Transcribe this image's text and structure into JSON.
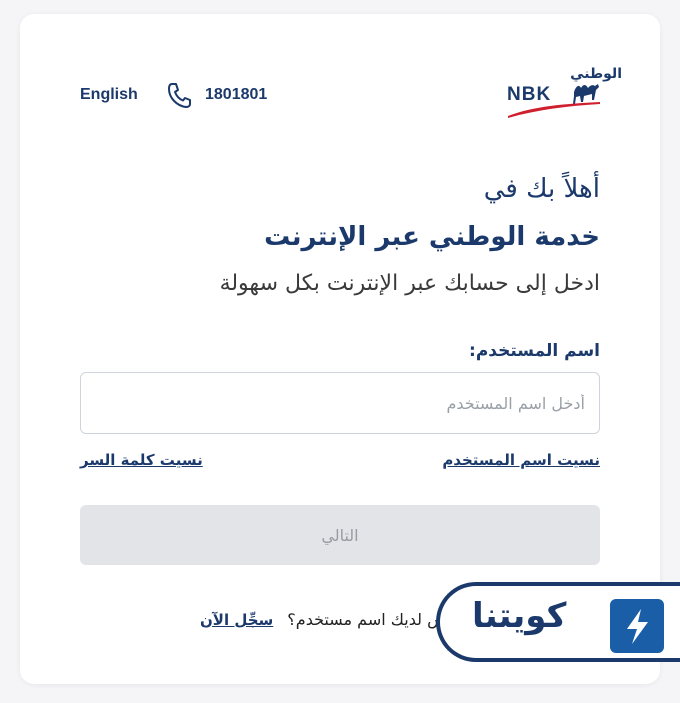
{
  "header": {
    "language_link": "English",
    "phone_number": "1801801",
    "logo_arabic": "الوطني",
    "logo_english": "NBK"
  },
  "main": {
    "welcome": "أهلاً بك في",
    "service_name": "خدمة الوطني عبر الإنترنت",
    "subtitle": "ادخل إلى حسابك عبر الإنترنت بكل سهولة",
    "username_label": "اسم المستخدم",
    "username_placeholder": "أدخل اسم المستخدم",
    "forgot_username": "نسيت اسم المستخدم",
    "forgot_password": "نسيت كلمة السر",
    "next_button": "التالي",
    "no_account_text": "ليس لديك اسم مستخدم؟",
    "register_link": "سجِّل الآن"
  },
  "watermark": {
    "text": "كويتنا"
  },
  "colors": {
    "brand": "#1b3a6b",
    "button_disabled_bg": "#e3e4e8",
    "logo_swoosh": "#d0202e"
  }
}
